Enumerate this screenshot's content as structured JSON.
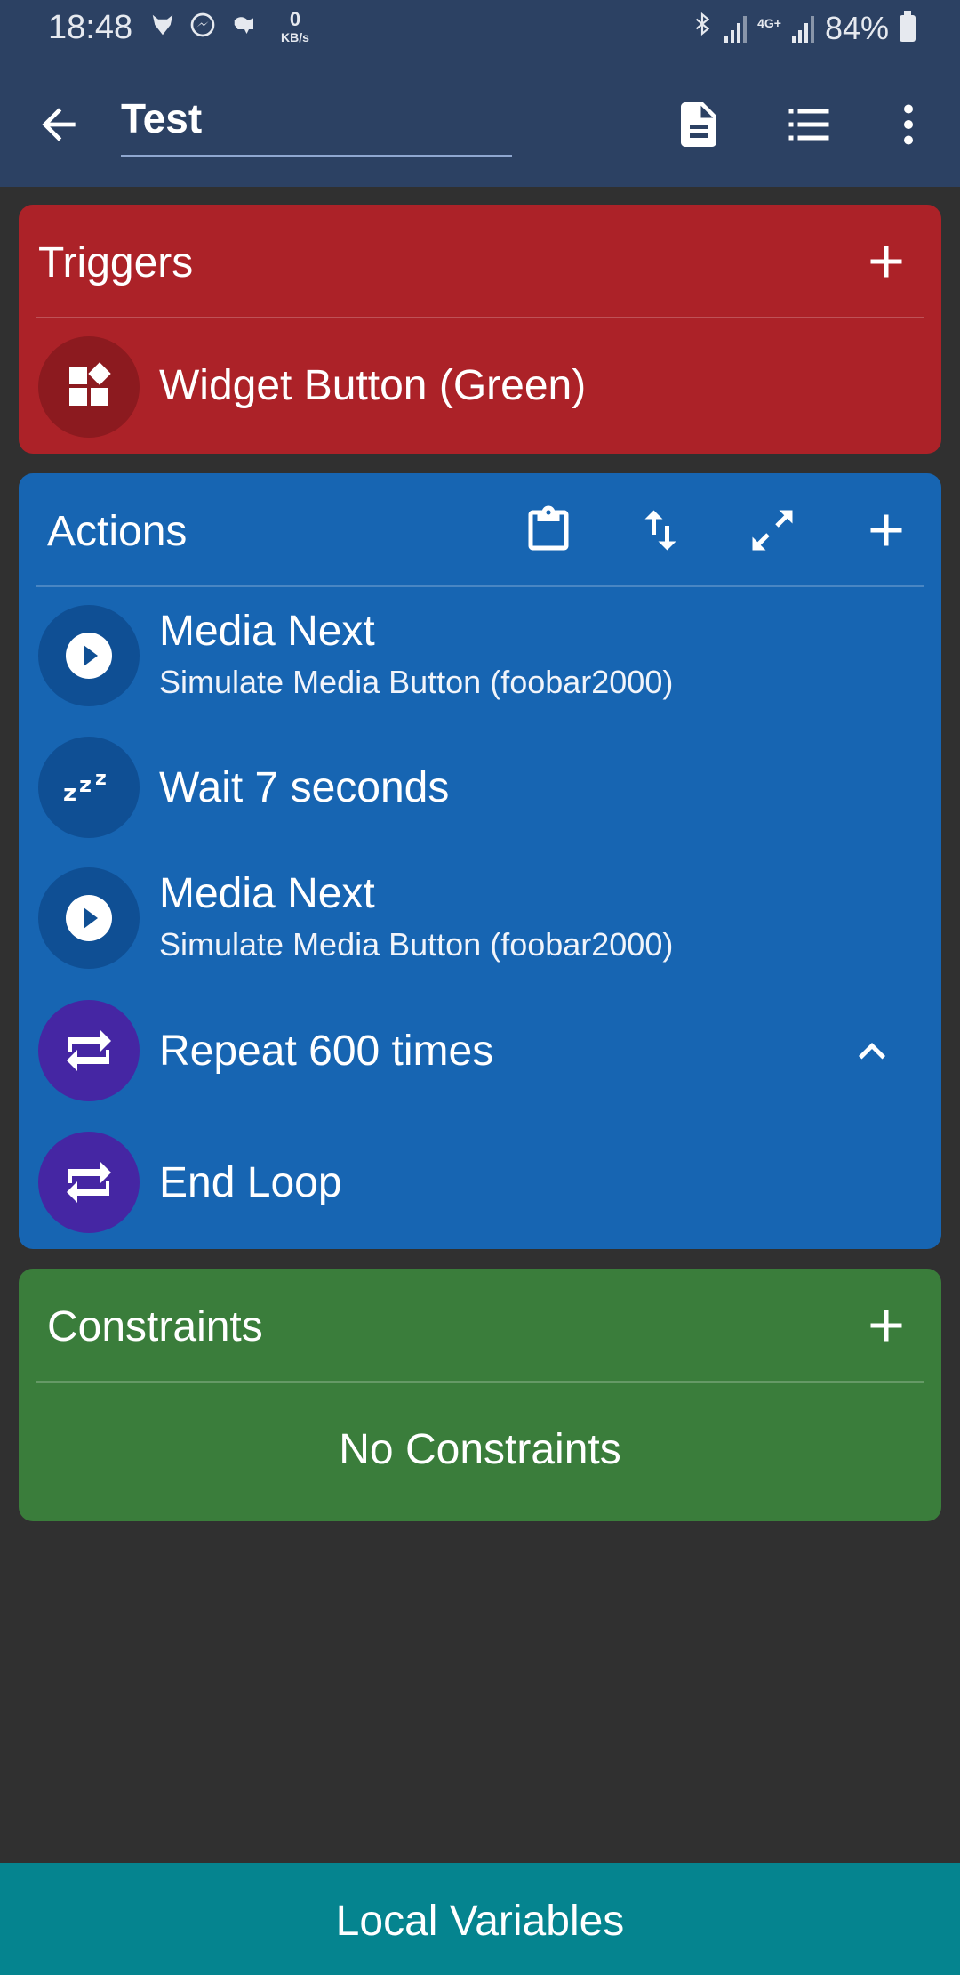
{
  "status_bar": {
    "time": "18:48",
    "net_speed_value": "0",
    "net_speed_unit": "KB/s",
    "network_type": "4G+",
    "battery": "84%"
  },
  "toolbar": {
    "title": "Test",
    "back_icon": "arrow-left-icon",
    "icons": [
      "document-icon",
      "list-icon",
      "more-vert-icon"
    ]
  },
  "triggers": {
    "label": "Triggers",
    "items": [
      {
        "title": "Widget Button (Green)",
        "icon": "widgets-icon"
      }
    ]
  },
  "actions": {
    "label": "Actions",
    "header_icons": [
      "clipboard-icon",
      "reorder-icon",
      "expand-icon",
      "add-icon"
    ],
    "items": [
      {
        "title": "Media Next",
        "subtitle": "Simulate Media Button (foobar2000)",
        "icon": "play-icon"
      },
      {
        "title": "Wait 7 seconds",
        "icon": "sleep-zzz-icon"
      },
      {
        "title": "Media Next",
        "subtitle": "Simulate Media Button (foobar2000)",
        "icon": "play-icon"
      },
      {
        "title": "Repeat 600 times",
        "icon": "repeat-icon"
      },
      {
        "title": "End Loop",
        "icon": "repeat-icon"
      }
    ]
  },
  "constraints": {
    "label": "Constraints",
    "empty_text": "No Constraints"
  },
  "bottom": {
    "label": "Local Variables"
  },
  "colors": {
    "toolbar": "#2c4163",
    "triggers": "#ac2228",
    "actions": "#1765b2",
    "constraints": "#3a7d3b",
    "bottom_bar": "#05848f",
    "loop_icon_bg": "#4526a3",
    "background": "#303030"
  }
}
